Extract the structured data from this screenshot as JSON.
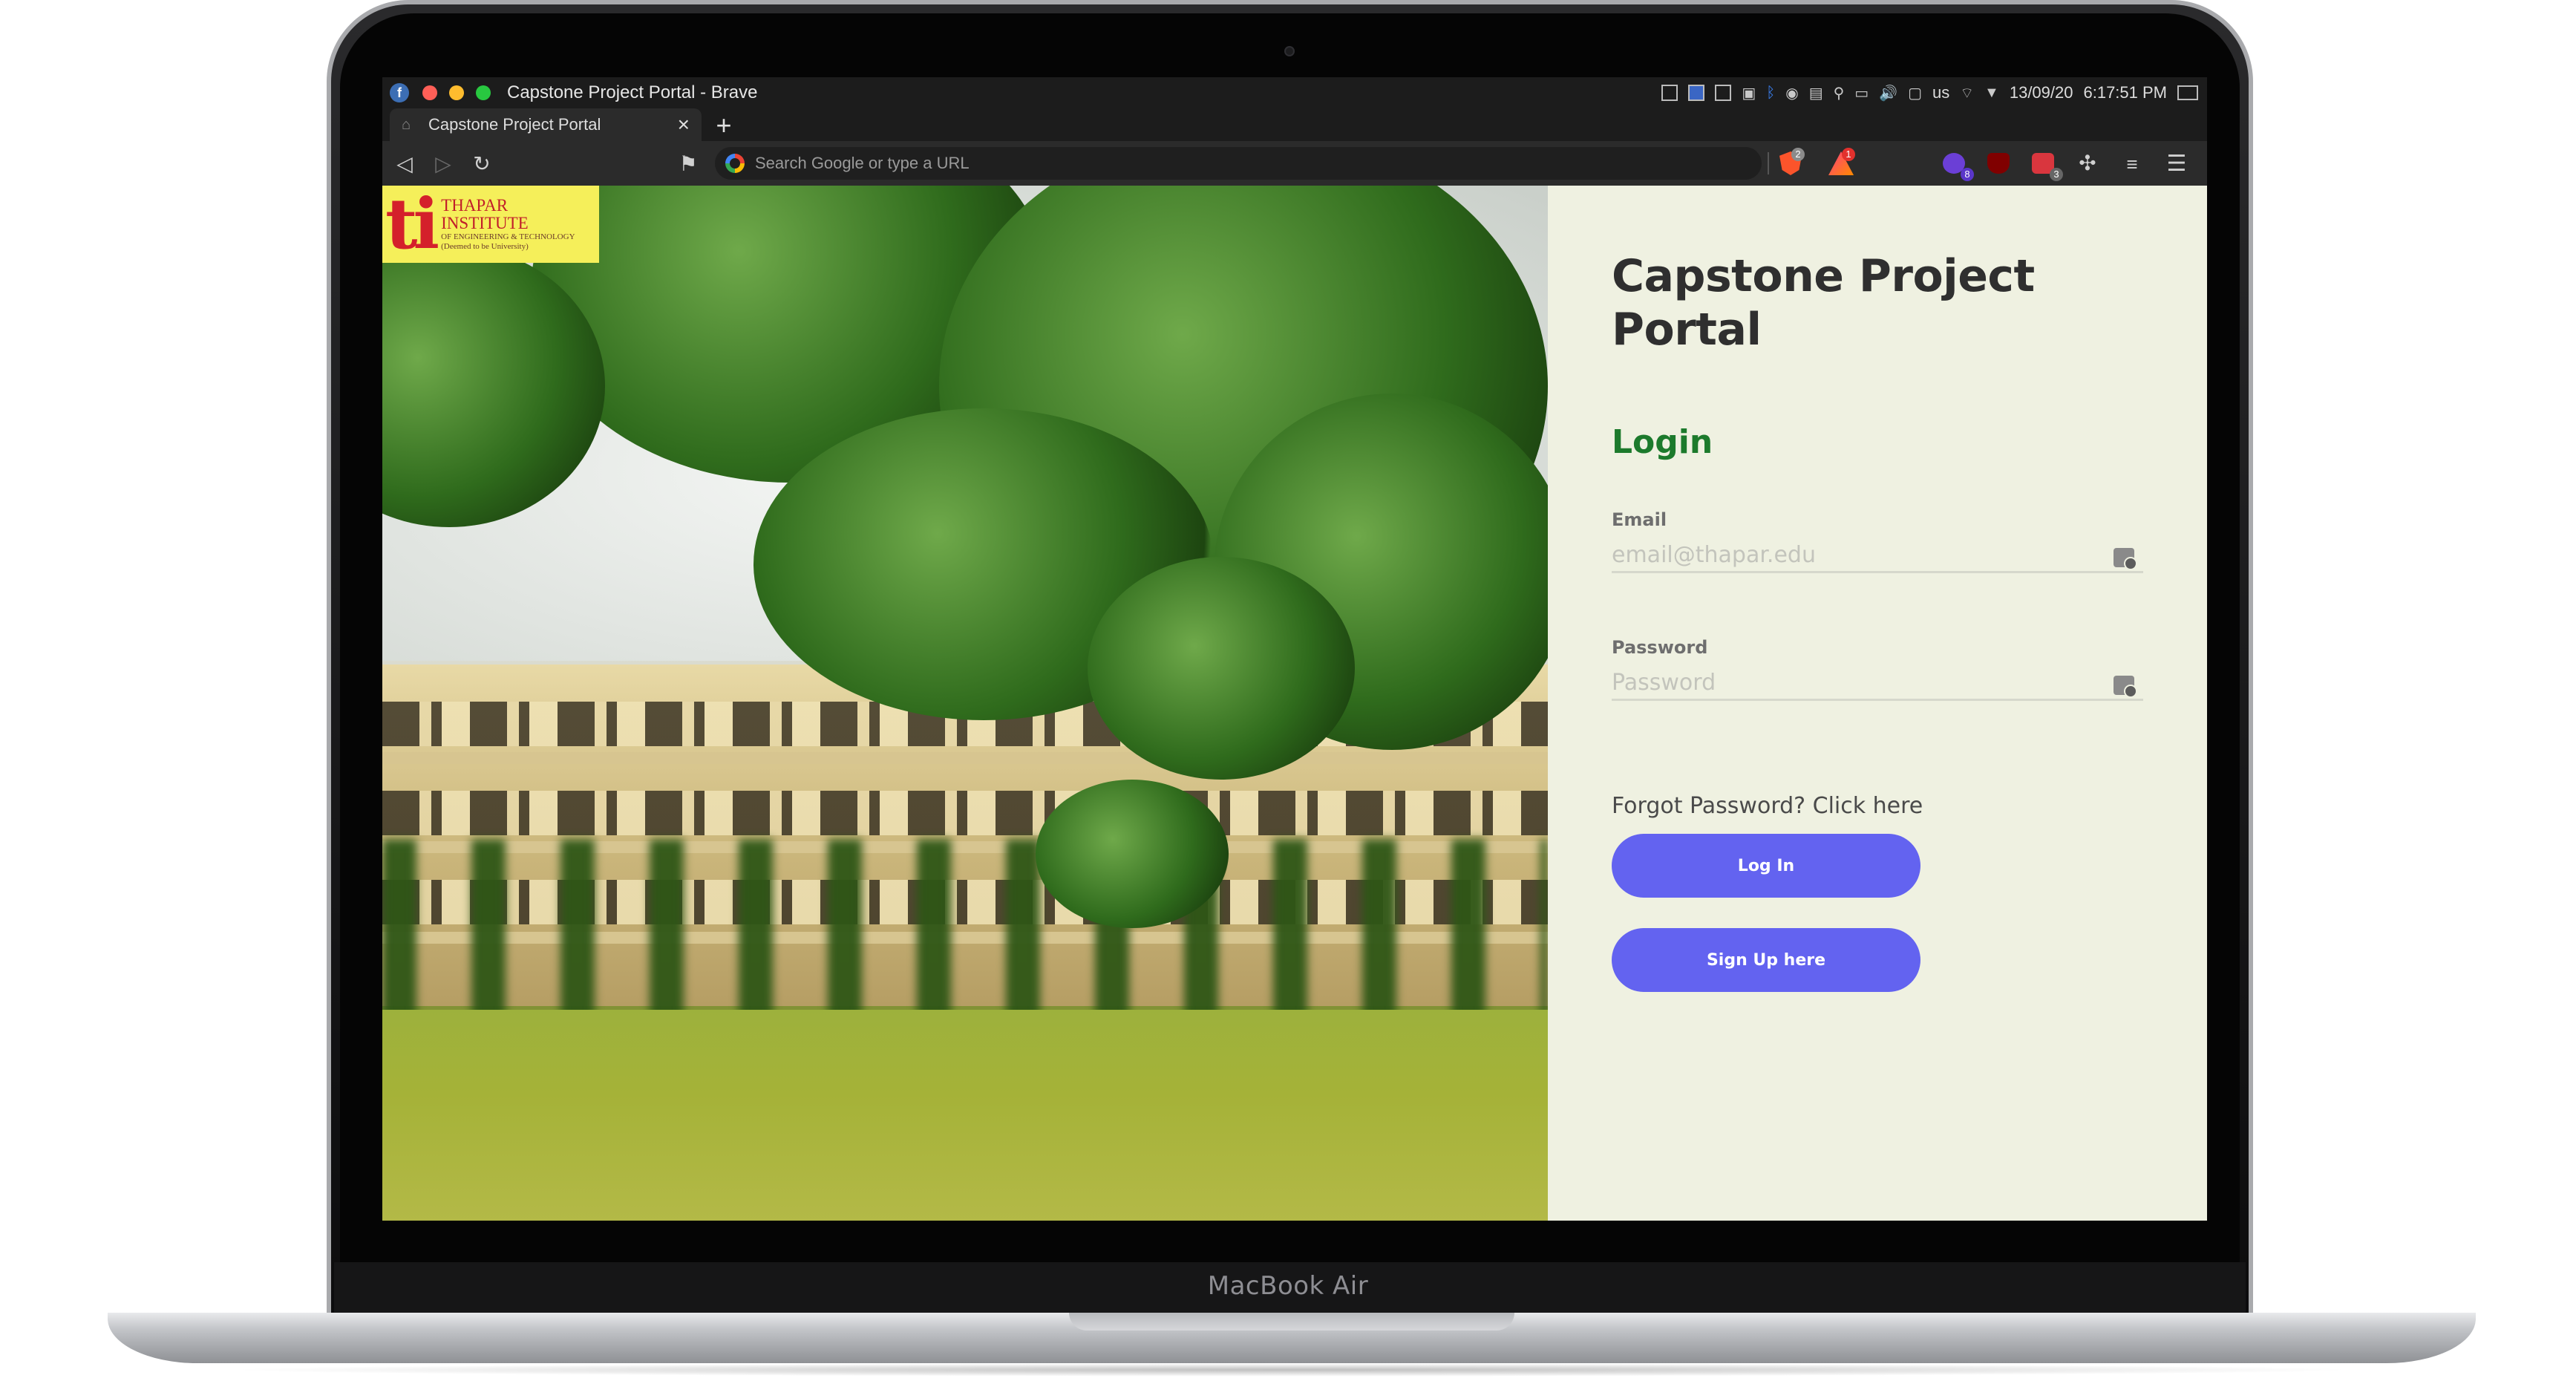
{
  "device": {
    "model_label": "MacBook Air"
  },
  "system_bar": {
    "os_icon": "fedora-icon",
    "window_title": "Capstone Project Portal - Brave",
    "keyboard_layout": "us",
    "date": "13/09/20",
    "time": "6:17:51 PM"
  },
  "browser": {
    "tab": {
      "title": "Capstone Project Portal",
      "favicon": "house-icon"
    },
    "omnibox": {
      "placeholder": "Search Google or type a URL"
    },
    "shield_badge": "2",
    "rewards_badge": "1",
    "extensions": [
      {
        "name": "purple-extension",
        "badge": "8"
      },
      {
        "name": "ublock-origin",
        "badge": ""
      },
      {
        "name": "red-extension",
        "badge": "3"
      }
    ]
  },
  "page": {
    "logo": {
      "mark": "ti",
      "name": "THAPAR INSTITUTE",
      "sub1": "OF ENGINEERING & TECHNOLOGY",
      "sub2": "(Deemed to be University)"
    },
    "title": "Capstone Project Portal",
    "login_heading": "Login",
    "email": {
      "label": "Email",
      "placeholder": "email@thapar.edu",
      "value": ""
    },
    "password": {
      "label": "Password",
      "placeholder": "Password",
      "value": ""
    },
    "forgot_text": "Forgot Password? Click here",
    "login_button": "Log In",
    "signup_button": "Sign Up here",
    "colors": {
      "accent": "#6363f0",
      "heading_green": "#1c7a2c",
      "panel_bg": "#eff1e1"
    }
  }
}
